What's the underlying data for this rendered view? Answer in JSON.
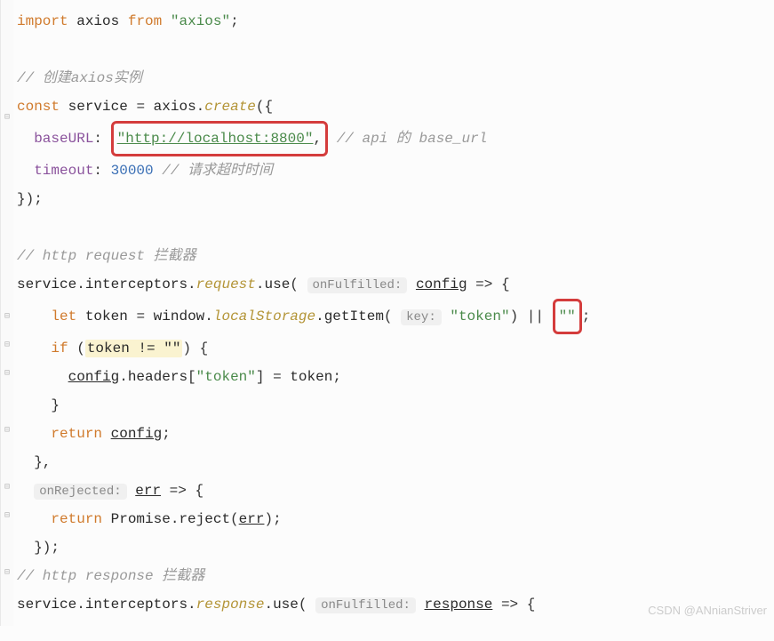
{
  "code": {
    "l1_kw1": "import",
    "l1_id": "axios",
    "l1_kw2": "from",
    "l1_str": "\"axios\"",
    "l1_semi": ";",
    "l2_cmt": "// 创建axios实例",
    "l3_kw": "const",
    "l3_id": "service",
    "l3_eq": " = ",
    "l3_ax": "axios",
    "l3_dot": ".",
    "l3_create": "create",
    "l3_open": "({",
    "l4_prop": "baseURL",
    "l4_colon": ": ",
    "l4_str": "\"http://localhost:8800\"",
    "l4_comma": ",",
    "l4_cmt": "// api 的 base_url",
    "l5_prop": "timeout",
    "l5_colon": ": ",
    "l5_num": "30000",
    "l5_cmt": " // 请求超时时间",
    "l6_close": "});",
    "l7_cmt": "// http request 拦截器",
    "l8_svc": "service",
    "l8_dot1": ".",
    "l8_intc": "interceptors",
    "l8_dot2": ".",
    "l8_req": "request",
    "l8_dot3": ".",
    "l8_use": "use",
    "l8_open": "( ",
    "l8_hint": "onFulfilled:",
    "l8_sp": " ",
    "l8_cfg": "config",
    "l8_arrow": " => {",
    "l9_let": "let",
    "l9_tok": "token",
    "l9_eq": " = ",
    "l9_win": "window",
    "l9_dot1": ".",
    "l9_ls": "localStorage",
    "l9_dot2": ".",
    "l9_get": "getItem",
    "l9_open": "( ",
    "l9_hint": "key:",
    "l9_sp": " ",
    "l9_str": "\"token\"",
    "l9_close": ")",
    "l9_or": " || ",
    "l9_empty": "\"\"",
    "l9_semi": ";",
    "l10_if": "if",
    "l10_open": " (",
    "l10_cond": "token != \"\"",
    "l10_close": ") {",
    "l11_cfg": "config",
    "l11_dot": ".",
    "l11_hdr": "headers",
    "l11_brk": "[",
    "l11_str": "\"token\"",
    "l11_brk2": "]",
    "l11_eq": " = ",
    "l11_tok": "token",
    "l11_semi": ";",
    "l12_close": "}",
    "l13_ret": "return",
    "l13_cfg": "config",
    "l13_semi": ";",
    "l14_close": "},",
    "l15_hint": "onRejected:",
    "l15_sp": " ",
    "l15_err": "err",
    "l15_arrow": " => {",
    "l16_ret": "return",
    "l16_prom": " Promise",
    "l16_dot": ".",
    "l16_rej": "reject",
    "l16_open": "(",
    "l16_err": "err",
    "l16_close": ")",
    "l16_semi": ";",
    "l17_close": "});",
    "l18_cmt": "// http response 拦截器",
    "l19_svc": "service",
    "l19_dot1": ".",
    "l19_intc": "interceptors",
    "l19_dot2": ".",
    "l19_resp": "response",
    "l19_dot3": ".",
    "l19_use": "use",
    "l19_open": "( ",
    "l19_hint": "onFulfilled:",
    "l19_sp": " ",
    "l19_r": "response",
    "l19_arrow": " => {"
  },
  "watermark": "CSDN @ANnianStriver"
}
